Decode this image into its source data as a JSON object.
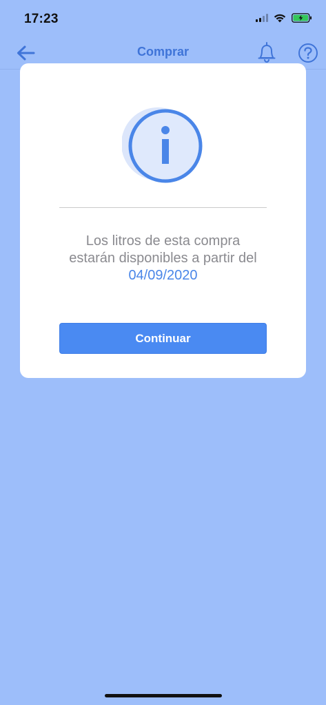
{
  "status_bar": {
    "time": "17:23",
    "icons": [
      "cellular-signal-icon",
      "wifi-icon",
      "battery-charging-icon"
    ]
  },
  "nav": {
    "title": "Comprar",
    "icons": [
      "back-arrow-icon",
      "bell-icon",
      "help-icon"
    ],
    "accent_color": "#3f74d8"
  },
  "modal": {
    "icon": "info-icon",
    "message_line_1": "Los litros de esta compra",
    "message_line_2": "estarán disponibles a partir del",
    "date": "04/09/2020",
    "button_label": "Continuar",
    "button_color": "#4a8af2",
    "date_color": "#4a86e8"
  },
  "colors": {
    "overlay_background": "#9dbefa"
  }
}
